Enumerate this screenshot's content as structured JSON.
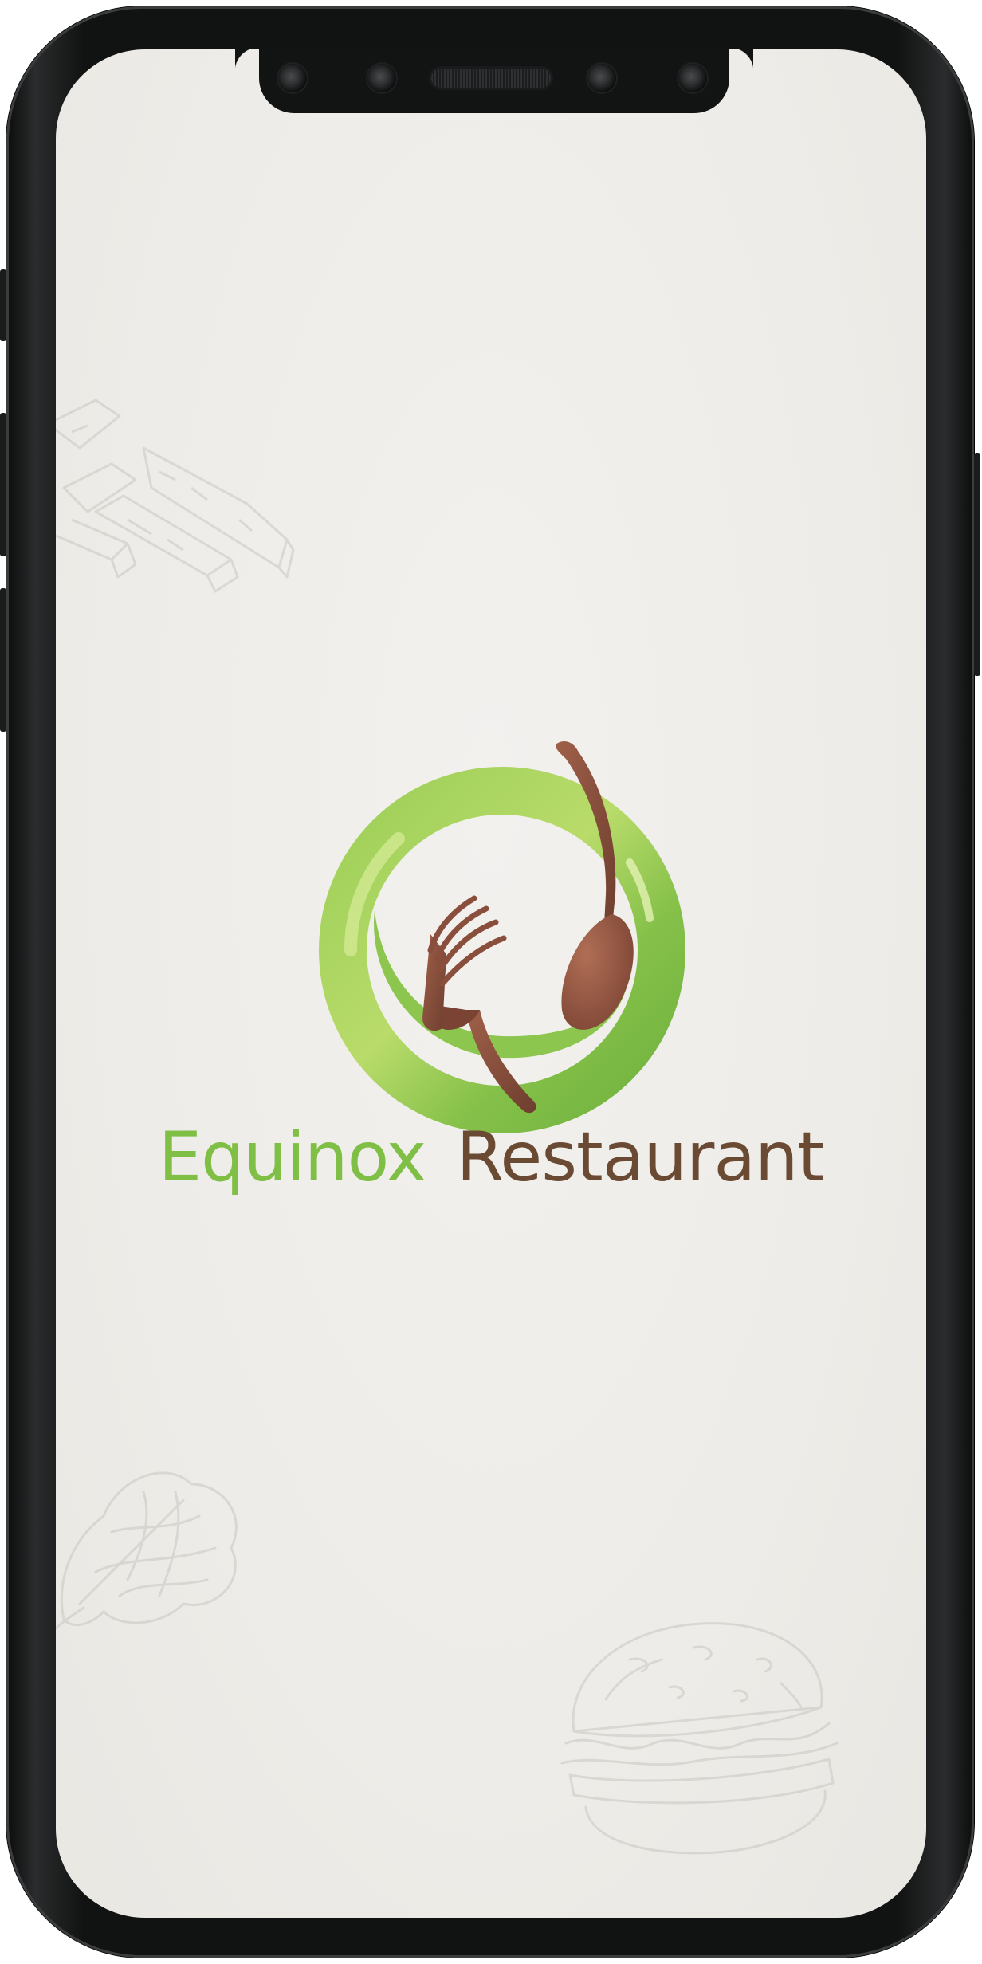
{
  "app": {
    "brand_name_first": "Equinox",
    "brand_name_second": "Restaurant"
  },
  "colors": {
    "brand_green": "#7fbf45",
    "brand_brown": "#6b4a33",
    "screen_background": "#efeeea",
    "device_frame": "#111212"
  },
  "icons": {
    "logo": "plate-fork-spoon-logo",
    "doodles": [
      "fries-doodle-icon",
      "lettuce-doodle-icon",
      "burger-doodle-icon"
    ]
  }
}
